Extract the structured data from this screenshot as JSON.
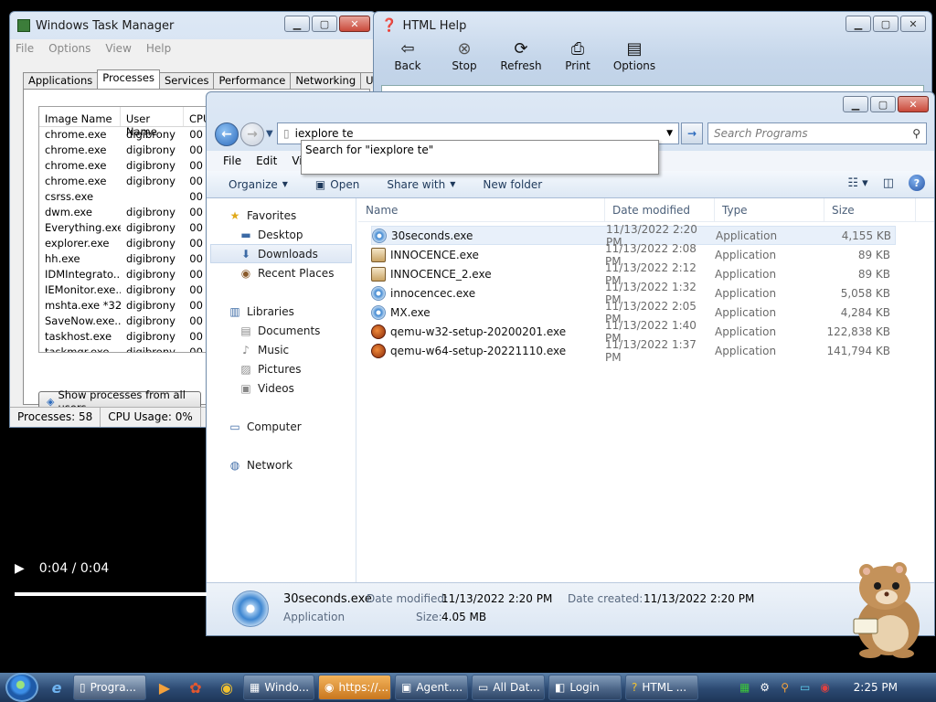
{
  "taskmgr": {
    "title": "Windows Task Manager",
    "menu": [
      "File",
      "Options",
      "View",
      "Help"
    ],
    "tabs": [
      "Applications",
      "Processes",
      "Services",
      "Performance",
      "Networking",
      "Users"
    ],
    "columns": [
      "Image Name",
      "User Name",
      "CPU"
    ],
    "rows": [
      [
        "chrome.exe",
        "digibrony",
        "00"
      ],
      [
        "chrome.exe",
        "digibrony",
        "00"
      ],
      [
        "chrome.exe",
        "digibrony",
        "00"
      ],
      [
        "chrome.exe",
        "digibrony",
        "00"
      ],
      [
        "csrss.exe",
        "",
        "00"
      ],
      [
        "dwm.exe",
        "digibrony",
        "00"
      ],
      [
        "Everything.exe",
        "digibrony",
        "00"
      ],
      [
        "explorer.exe",
        "digibrony",
        "00"
      ],
      [
        "hh.exe",
        "digibrony",
        "00"
      ],
      [
        "IDMIntegrato...",
        "digibrony",
        "00"
      ],
      [
        "IEMonitor.exe...",
        "digibrony",
        "00"
      ],
      [
        "mshta.exe *32",
        "digibrony",
        "00"
      ],
      [
        "SaveNow.exe...",
        "digibrony",
        "00"
      ],
      [
        "taskhost.exe",
        "digibrony",
        "00"
      ],
      [
        "taskmgr.exe",
        "digibrony",
        "00"
      ]
    ],
    "show_all_label": "Show processes from all users",
    "status_processes": "Processes: 58",
    "status_cpu": "CPU Usage: 0%"
  },
  "htmlhelp": {
    "title": "HTML Help",
    "tools": [
      "Back",
      "Stop",
      "Refresh",
      "Print",
      "Options"
    ]
  },
  "explorer": {
    "address_value": "iexplore te",
    "search_placeholder": "Search Programs",
    "menu": [
      "File",
      "Edit",
      "Vie"
    ],
    "commands": {
      "organize": "Organize",
      "open": "Open",
      "share": "Share with",
      "newfolder": "New folder"
    },
    "nav": {
      "favorites": "Favorites",
      "desktop": "Desktop",
      "downloads": "Downloads",
      "recent": "Recent Places",
      "libraries": "Libraries",
      "documents": "Documents",
      "music": "Music",
      "pictures": "Pictures",
      "videos": "Videos",
      "computer": "Computer",
      "network": "Network"
    },
    "columns": [
      "Name",
      "Date modified",
      "Type",
      "Size"
    ],
    "files": [
      {
        "name": "30seconds.exe",
        "date": "11/13/2022 2:20 PM",
        "type": "Application",
        "size": "4,155 KB",
        "icon": "disc-icon"
      },
      {
        "name": "INNOCENCE.exe",
        "date": "11/13/2022 2:08 PM",
        "type": "Application",
        "size": "89 KB",
        "icon": "app-icon"
      },
      {
        "name": "INNOCENCE_2.exe",
        "date": "11/13/2022 2:12 PM",
        "type": "Application",
        "size": "89 KB",
        "icon": "app-icon"
      },
      {
        "name": "innocencec.exe",
        "date": "11/13/2022 1:32 PM",
        "type": "Application",
        "size": "5,058 KB",
        "icon": "disc-icon"
      },
      {
        "name": "MX.exe",
        "date": "11/13/2022 2:05 PM",
        "type": "Application",
        "size": "4,284 KB",
        "icon": "disc-icon"
      },
      {
        "name": "qemu-w32-setup-20200201.exe",
        "date": "11/13/2022 1:40 PM",
        "type": "Application",
        "size": "122,838 KB",
        "icon": "qemu-icon"
      },
      {
        "name": "qemu-w64-setup-20221110.exe",
        "date": "11/13/2022 1:37 PM",
        "type": "Application",
        "size": "141,794 KB",
        "icon": "qemu-icon"
      }
    ],
    "details": {
      "name": "30seconds.exe",
      "kind": "Application",
      "modified_label": "Date modified:",
      "modified_value": "11/13/2022 2:20 PM",
      "created_label": "Date created:",
      "created_value": "11/13/2022 2:20 PM",
      "size_label": "Size:",
      "size_value": "4.05 MB"
    }
  },
  "suggestion": "Search for \"iexplore te\"",
  "video": {
    "time": "0:04 / 0:04"
  },
  "taskbar": {
    "buttons": [
      "Progra...",
      "Windo...",
      "https://...",
      "Agent....",
      "All Dat...",
      "Login",
      "HTML ..."
    ],
    "clock": "2:25 PM"
  },
  "colors": {
    "accent": "#2d6bbd",
    "taskbar": "#2c4a72",
    "selection": "#e8f0fa"
  }
}
